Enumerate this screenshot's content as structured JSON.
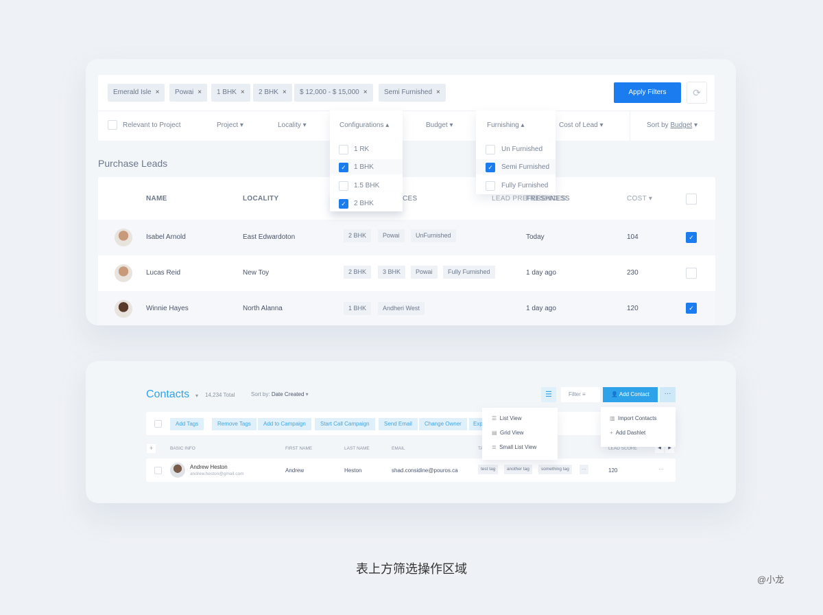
{
  "filters": {
    "chips": [
      "Emerald Isle",
      "Powai",
      "1 BHK",
      "2 BHK",
      "$ 12,000 - $ 15,000",
      "Semi Furnished"
    ],
    "apply_label": "Apply Filters",
    "refresh_icon": "refresh-icon",
    "headers": {
      "relevant": "Relevant to Project",
      "project": "Project ▾",
      "locality": "Locality ▾",
      "configurations": "Configurations ▴",
      "budget": "Budget ▾",
      "furnishing": "Furnishing ▴",
      "cost_of_lead": "Cost of Lead ▾",
      "sort_by": "Sort by",
      "sort_value": "Budget",
      "sort_caret": "▾"
    },
    "config_options": [
      {
        "label": "1 RK",
        "checked": false
      },
      {
        "label": "1 BHK",
        "checked": true
      },
      {
        "label": "1.5 BHK",
        "checked": false
      },
      {
        "label": "2 BHK",
        "checked": true
      }
    ],
    "furnishing_options": [
      {
        "label": "Un Furnished",
        "checked": false
      },
      {
        "label": "Semi Furnished",
        "checked": true
      },
      {
        "label": "Fully Furnished",
        "checked": false
      }
    ]
  },
  "leads": {
    "title": "Purchase Leads",
    "columns": [
      "NAME",
      "LOCALITY",
      "CES",
      "LEAD PREFERENCES",
      "FRESHNESS",
      "COST ▾"
    ],
    "rows": [
      {
        "name": "Isabel Arnold",
        "locality": "East Edwardoton",
        "tags": [
          "2 BHK",
          "Powai",
          "UnFurnished"
        ],
        "freshness": "Today",
        "cost": "104",
        "checked": true
      },
      {
        "name": "Lucas Reid",
        "locality": "New Toy",
        "tags": [
          "2 BHK",
          "3 BHK",
          "Powai",
          "Fully Furnished"
        ],
        "freshness": "1 day ago",
        "cost": "230",
        "checked": false
      },
      {
        "name": "Winnie Hayes",
        "locality": "North Alanna",
        "tags": [
          "1 BHK",
          "Andheri West"
        ],
        "freshness": "1 day ago",
        "cost": "120",
        "checked": true
      }
    ]
  },
  "contacts": {
    "title": "Contacts",
    "total": "14,234 Total",
    "sort_label": "Sort by:",
    "sort_value": "Date Created",
    "filter_label": "Filter",
    "add_contact": "Add Contact",
    "bulk_actions": [
      "Add Tags",
      "Remove Tags",
      "Add to Campaign",
      "Start Call Campaign",
      "Send Email",
      "Change Owner",
      "Exp"
    ],
    "view_menu": [
      "List View",
      "Grid View",
      "Small List View"
    ],
    "more_menu": [
      "Import Contacts",
      "Add Dashlet"
    ],
    "columns": [
      "BASIC INFO",
      "FIRST NAME",
      "LAST NAME",
      "EMAIL",
      "TA",
      "LEAD SCORE"
    ],
    "row": {
      "name": "Andrew Heston",
      "email_sub": "andrew.heston@gmail.com",
      "first": "Andrew",
      "last": "Heston",
      "email": "shad.considine@pouros.ca",
      "tags": [
        "test tag",
        "another tag",
        "something tag",
        "···"
      ],
      "score": "120",
      "more": "···"
    }
  },
  "caption": "表上方筛选操作区域",
  "watermark": "@小龙",
  "colors": {
    "accent": "#1b7cf0",
    "contacts_accent": "#2ea3ea"
  }
}
